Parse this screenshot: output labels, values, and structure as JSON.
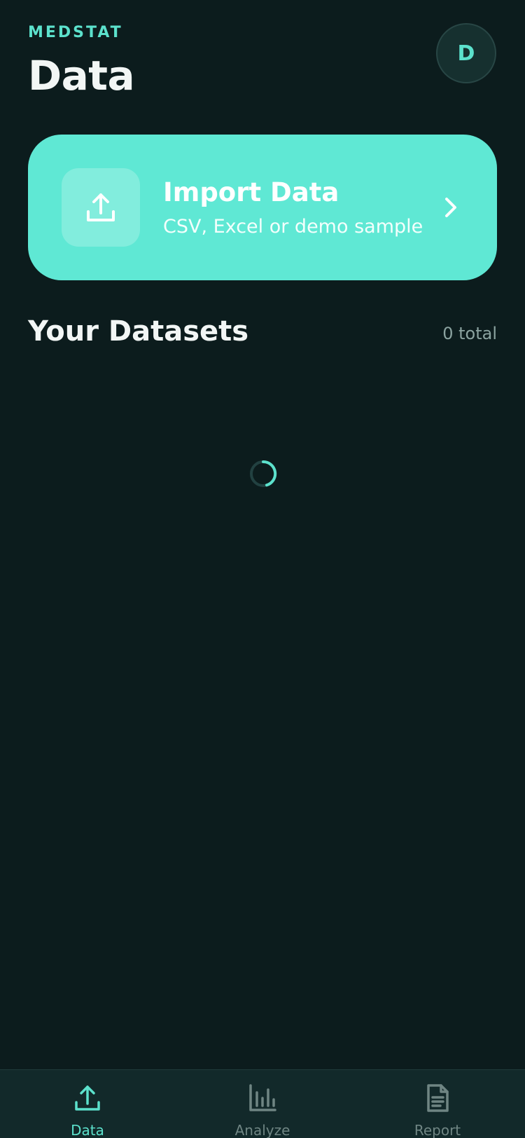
{
  "header": {
    "brand": "MEDSTAT",
    "title": "Data",
    "avatar_initial": "D"
  },
  "import_card": {
    "title": "Import Data",
    "subtitle": "CSV, Excel or demo sample",
    "icon": "upload-icon",
    "chevron_icon": "chevron-right-icon"
  },
  "datasets": {
    "title": "Your Datasets",
    "count_label": "0 total",
    "loading": true
  },
  "bottom_nav": {
    "items": [
      {
        "label": "Data",
        "icon": "upload-icon",
        "active": true
      },
      {
        "label": "Analyze",
        "icon": "bar-chart-icon",
        "active": false
      },
      {
        "label": "Report",
        "icon": "document-icon",
        "active": false
      }
    ]
  },
  "colors": {
    "background": "#0c1c1d",
    "accent": "#5ce1cc",
    "card": "#5fe8d4",
    "nav_background": "#12292a"
  }
}
